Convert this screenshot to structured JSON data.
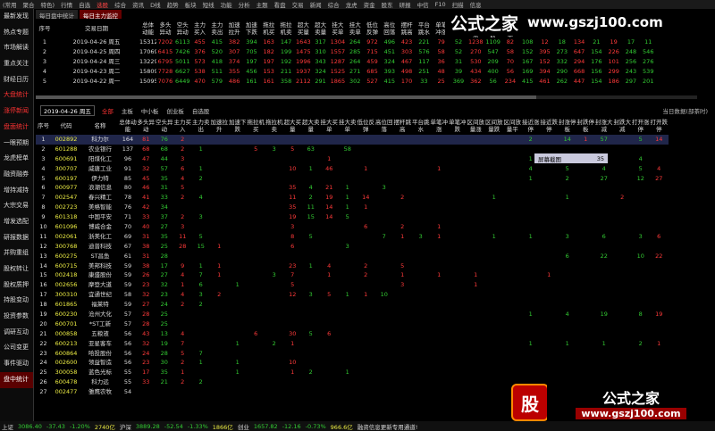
{
  "menu": [
    "(常用",
    "聚合",
    "特色)",
    "行情",
    "自选",
    "选股",
    "综合",
    "资讯",
    "D线",
    "趋势",
    "板块",
    "短线",
    "功能",
    "分析",
    "主题",
    "看盘",
    "交易",
    "新闻",
    "综合",
    "龙虎",
    "资金",
    "股东",
    "研报",
    "中信",
    "F10",
    "扫描",
    "信息"
  ],
  "menu_active_index": 5,
  "watermark": {
    "brand": "公式之家",
    "url": "www.gszj100.com"
  },
  "sidebar": [
    "最新发现",
    "热点专题",
    "市场解读",
    "重点关注",
    "财经日历",
    "大盘统计",
    "涨停新闻",
    "盘面统计",
    "一眼预期",
    "龙虎榜单",
    "融资融券",
    "增持减持",
    "大宗交易",
    "增发选配",
    "研报数据",
    "并购重组",
    "股权转让",
    "股权质押",
    "持股变动",
    "投资参数",
    "调研互动",
    "公司变更",
    "事件驱动",
    "盘中统计"
  ],
  "sidebar_red": [
    5,
    6,
    7
  ],
  "sidebar_selected": 23,
  "tabs": [
    "每日盘中统计",
    "每日主力监控"
  ],
  "top_table": {
    "headers": [
      "序号",
      "交易日期",
      "总体动能",
      "多头异动",
      "空头异动",
      "主力买入",
      "主力卖出",
      "加速拉升",
      "加速下跌",
      "拖拉机买",
      "拖拉机卖",
      "超大买量",
      "超大卖量",
      "挂大买单",
      "挂大卖单",
      "低位反弹",
      "高位回落",
      "摆杆跳高",
      "平台跳水",
      "单笔冲涨",
      "单笔冲跌",
      "区间放量涨",
      "区间放量跌",
      "区间放量平",
      "接近涨停",
      "接近跌停",
      "封涨停板",
      "封跌停板",
      "封涨大减",
      "封跌大减",
      "打开涨停",
      "打开跌停"
    ],
    "rows": [
      [
        "1",
        "2019-04-26 周五",
        "15312",
        "7202",
        "6113",
        "455",
        "415",
        "382",
        "394",
        "163",
        "147",
        "1643",
        "317",
        "1304",
        "264",
        "972",
        "496",
        "423",
        "221",
        "79",
        "52",
        "1238",
        "1109",
        "82",
        "108",
        "12",
        "18",
        "134",
        "21",
        "19",
        "17",
        "11"
      ],
      [
        "2",
        "2019-04-25 周四",
        "17069",
        "6415",
        "7426",
        "376",
        "520",
        "307",
        "705",
        "182",
        "199",
        "1475",
        "310",
        "1557",
        "285",
        "715",
        "451",
        "303",
        "576",
        "58",
        "52",
        "270",
        "547",
        "58",
        "152",
        "395",
        "273",
        "647",
        "154",
        "226",
        "248",
        "546"
      ],
      [
        "3",
        "2019-04-24 周三",
        "13229",
        "6795",
        "5011",
        "573",
        "418",
        "374",
        "197",
        "197",
        "192",
        "1996",
        "343",
        "1287",
        "264",
        "459",
        "324",
        "467",
        "117",
        "36",
        "31",
        "530",
        "209",
        "70",
        "167",
        "152",
        "332",
        "294",
        "176",
        "101",
        "256",
        "276"
      ],
      [
        "4",
        "2019-04-23 周二",
        "15809",
        "7728",
        "6627",
        "538",
        "511",
        "355",
        "456",
        "153",
        "211",
        "1937",
        "324",
        "1525",
        "271",
        "685",
        "393",
        "498",
        "251",
        "48",
        "39",
        "434",
        "400",
        "56",
        "169",
        "394",
        "290",
        "668",
        "156",
        "299",
        "243",
        "539"
      ],
      [
        "5",
        "2019-04-22 周一",
        "15095",
        "7076",
        "6449",
        "470",
        "579",
        "486",
        "161",
        "161",
        "358",
        "2112",
        "291",
        "1865",
        "302",
        "527",
        "415",
        "170",
        "33",
        "25",
        "369",
        "362",
        "56",
        "234",
        "415",
        "461",
        "262",
        "447",
        "154",
        "186",
        "297",
        "201"
      ]
    ]
  },
  "controls": {
    "date": "2019-04-26 周五",
    "options": [
      "全部",
      "主板",
      "中小板",
      "创业板",
      "自选股"
    ],
    "active_option": 0,
    "right_label": "当日数据(部茶时)"
  },
  "bottom_table": {
    "headers": [
      "序号",
      "代码",
      "名称",
      "总体动能",
      "多头异动",
      "空头异动",
      "主力买入",
      "主力卖出",
      "加速拉升",
      "加速下跌",
      "拖拉机买",
      "拖拉机卖",
      "超大买量",
      "超大卖量",
      "挂大买单",
      "挂大卖单",
      "低位反弹",
      "高位回落",
      "摆杆跳高",
      "平台跳水",
      "单笔冲涨",
      "单笔冲跌",
      "区间放量涨",
      "区间放量跌",
      "区间放量平",
      "接近涨停",
      "接近跌停",
      "封涨停板",
      "封跌停板",
      "封涨大减",
      "封跌大减",
      "打开涨停",
      "打开跌停"
    ],
    "rows": [
      [
        "1",
        "002892",
        "科力尔",
        "164",
        "81",
        "76",
        "2",
        "",
        "",
        "",
        "",
        "",
        "",
        "",
        "",
        "",
        "",
        "",
        "",
        "",
        "",
        "",
        "",
        "",
        "",
        "2",
        "",
        "14",
        "1",
        "57",
        "",
        "5",
        "14"
      ],
      [
        "2",
        "601288",
        "农业银行",
        "137",
        "68",
        "68",
        "2",
        "1",
        "",
        "",
        "5",
        "3",
        "5",
        "63",
        "",
        "58",
        "",
        "",
        "",
        "",
        "",
        "",
        "",
        "",
        "",
        "",
        "",
        "",
        "",
        "",
        "",
        "",
        ""
      ],
      [
        "3",
        "600691",
        "阳煤化工",
        "96",
        "47",
        "44",
        "3",
        "",
        "",
        "",
        "",
        "",
        "",
        "",
        "1",
        "",
        "",
        "",
        "",
        "",
        "",
        "",
        "",
        "",
        "",
        "1",
        "",
        "5",
        "4",
        "2",
        "",
        "4",
        ""
      ],
      [
        "4",
        "300707",
        "威唐工业",
        "91",
        "32",
        "57",
        "6",
        "1",
        "",
        "",
        "",
        "",
        "10",
        "1",
        "46",
        "",
        "1",
        "",
        "",
        "",
        "1",
        "",
        "",
        "",
        "",
        "4",
        "",
        "5",
        "",
        "4",
        "",
        "5",
        "4"
      ],
      [
        "5",
        "600197",
        "伊力特",
        "85",
        "45",
        "35",
        "4",
        "2",
        "",
        "",
        "",
        "",
        "",
        "",
        "",
        "",
        "",
        "",
        "",
        "",
        "",
        "",
        "",
        "",
        "",
        "1",
        "",
        "2",
        "",
        "27",
        "",
        "12",
        "27"
      ],
      [
        "6",
        "000977",
        "浪潮信息",
        "80",
        "46",
        "31",
        "5",
        "",
        "",
        "",
        "",
        "",
        "35",
        "4",
        "21",
        "1",
        "",
        "3",
        "",
        "",
        "",
        "",
        "",
        "",
        "",
        "",
        "",
        "",
        "",
        "",
        "",
        "",
        ""
      ],
      [
        "7",
        "002547",
        "春兴精工",
        "78",
        "41",
        "33",
        "2",
        "4",
        "",
        "",
        "",
        "",
        "11",
        "2",
        "19",
        "1",
        "14",
        "",
        "2",
        "",
        "",
        "",
        "",
        "1",
        "",
        "",
        "",
        "1",
        "",
        "",
        "2",
        "",
        ""
      ],
      [
        "8",
        "002723",
        "美格智能",
        "76",
        "42",
        "34",
        "",
        "",
        "",
        "",
        "",
        "",
        "35",
        "11",
        "14",
        "1",
        "1",
        "",
        "",
        "",
        "",
        "",
        "",
        "",
        "",
        "",
        "",
        "",
        "",
        "",
        "",
        "",
        ""
      ],
      [
        "9",
        "601318",
        "中国平安",
        "71",
        "33",
        "37",
        "2",
        "3",
        "",
        "",
        "",
        "",
        "19",
        "15",
        "14",
        "5",
        "",
        "",
        "",
        "",
        "",
        "",
        "",
        "",
        "",
        "",
        "",
        "",
        "",
        "",
        "",
        "",
        ""
      ],
      [
        "10",
        "601096",
        "博威合金",
        "70",
        "40",
        "27",
        "3",
        "",
        "",
        "",
        "",
        "",
        "3",
        "",
        "",
        "",
        "6",
        "",
        "2",
        "",
        "1",
        "",
        "",
        "",
        "",
        "",
        "",
        "",
        "",
        "",
        "",
        "",
        ""
      ],
      [
        "11",
        "002061",
        "浙美化工",
        "69",
        "31",
        "35",
        "11",
        "5",
        "",
        "",
        "",
        "",
        "8",
        "5",
        "",
        "",
        "",
        "7",
        "1",
        "3",
        "1",
        "",
        "",
        "1",
        "",
        "1",
        "",
        "3",
        "",
        "6",
        "",
        "3",
        "6"
      ],
      [
        "12",
        "300768",
        "迪普科技",
        "67",
        "38",
        "25",
        "28",
        "15",
        "1",
        "",
        "",
        "",
        "6",
        "",
        "",
        "3",
        "",
        "",
        "",
        "",
        "",
        "",
        "",
        "",
        "",
        "",
        "",
        "",
        "",
        "",
        "",
        "",
        ""
      ],
      [
        "13",
        "600275",
        "ST昌鱼",
        "61",
        "31",
        "28",
        "",
        "",
        "",
        "",
        "",
        "",
        "",
        "",
        "",
        "",
        "",
        "",
        "",
        "",
        "",
        "",
        "",
        "",
        "",
        "",
        "",
        "6",
        "",
        "22",
        "",
        "10",
        "22"
      ],
      [
        "14",
        "600715",
        "美邦科技",
        "59",
        "38",
        "17",
        "9",
        "1",
        "1",
        "",
        "",
        "",
        "23",
        "1",
        "4",
        "",
        "2",
        "",
        "5",
        "",
        "",
        "",
        "",
        "",
        "",
        "",
        "",
        "",
        "",
        "",
        "",
        "",
        ""
      ],
      [
        "15",
        "002418",
        "康盛股份",
        "59",
        "26",
        "27",
        "4",
        "7",
        "1",
        "",
        "",
        "3",
        "7",
        "",
        "1",
        "",
        "2",
        "",
        "1",
        "",
        "1",
        "",
        "1",
        "",
        "",
        "",
        "1",
        "",
        "",
        "",
        "",
        "",
        ""
      ],
      [
        "16",
        "002656",
        "摩登大道",
        "59",
        "23",
        "32",
        "1",
        "6",
        "",
        "1",
        "",
        "",
        "5",
        "",
        "",
        "",
        "",
        "",
        "3",
        "",
        "",
        "",
        "1",
        "",
        "",
        "",
        "",
        "",
        "",
        "",
        "",
        "",
        ""
      ],
      [
        "17",
        "300310",
        "宜通世纪",
        "58",
        "32",
        "23",
        "4",
        "3",
        "2",
        "",
        "",
        "",
        "12",
        "3",
        "5",
        "1",
        "1",
        "10",
        "",
        "",
        "",
        "",
        "",
        "",
        "",
        "",
        "",
        "",
        "",
        "",
        "",
        "",
        ""
      ],
      [
        "18",
        "601865",
        "福莱特",
        "59",
        "27",
        "24",
        "2",
        "2",
        "",
        "",
        "",
        "",
        "",
        "",
        "",
        "",
        "",
        "",
        "",
        "",
        "",
        "",
        "",
        "",
        "",
        "",
        "",
        "",
        "",
        "",
        "",
        "",
        ""
      ],
      [
        "19",
        "600230",
        "沧州大化",
        "57",
        "28",
        "25",
        "",
        "",
        "",
        "",
        "",
        "",
        "",
        "",
        "",
        "",
        "",
        "",
        "",
        "",
        "",
        "",
        "",
        "",
        "",
        "1",
        "",
        "4",
        "",
        "19",
        "",
        "8",
        "19"
      ],
      [
        "20",
        "600701",
        "*ST工新",
        "57",
        "28",
        "25",
        "",
        "",
        "",
        "",
        "",
        "",
        "",
        "",
        "",
        "",
        "",
        "",
        "",
        "",
        "",
        "",
        "",
        "",
        "",
        "",
        "",
        "",
        "",
        "",
        "",
        "",
        ""
      ],
      [
        "21",
        "000858",
        "五粮液",
        "56",
        "43",
        "13",
        "4",
        "",
        "",
        "",
        "6",
        "",
        "30",
        "5",
        "6",
        "",
        "",
        "",
        "",
        "",
        "",
        "",
        "",
        "",
        "",
        "",
        "",
        "",
        "",
        "",
        "",
        "",
        ""
      ],
      [
        "22",
        "600213",
        "亚星客车",
        "56",
        "32",
        "19",
        "7",
        "",
        "",
        "1",
        "",
        "2",
        "1",
        "",
        "",
        "",
        "",
        "",
        "",
        "",
        "",
        "",
        "",
        "",
        "",
        "1",
        "",
        "1",
        "",
        "1",
        "",
        "2",
        "1"
      ],
      [
        "23",
        "600864",
        "哈投股份",
        "56",
        "24",
        "28",
        "5",
        "7",
        "",
        "",
        "",
        "",
        "",
        "",
        "",
        "",
        "",
        "",
        "",
        "",
        "",
        "",
        "",
        "",
        "",
        "",
        "",
        "",
        "",
        "",
        "",
        "",
        ""
      ],
      [
        "24",
        "002600",
        "领益智造",
        "56",
        "23",
        "30",
        "2",
        "1",
        "",
        "1",
        "",
        "",
        "10",
        "",
        "",
        "",
        "",
        "",
        "",
        "",
        "",
        "",
        "",
        "",
        "",
        "",
        "",
        "",
        "",
        "",
        "",
        "",
        ""
      ],
      [
        "25",
        "300058",
        "蓝色光标",
        "55",
        "17",
        "35",
        "1",
        "",
        "",
        "1",
        "",
        "",
        "1",
        "2",
        "",
        "1",
        "",
        "",
        "",
        "",
        "",
        "",
        "",
        "",
        "",
        "",
        "",
        "",
        "",
        "",
        "",
        "",
        ""
      ],
      [
        "26",
        "600478",
        "科力远",
        "55",
        "33",
        "21",
        "2",
        "2",
        "",
        "",
        "",
        "",
        "",
        "",
        "",
        "",
        "",
        "",
        "",
        "",
        "",
        "",
        "",
        "",
        "",
        "",
        "",
        "",
        "",
        "",
        "",
        "",
        ""
      ],
      [
        "27",
        "002477",
        "雏鹰农牧",
        "54",
        "",
        "",
        "",
        "",
        "",
        "",
        "",
        "",
        "",
        "",
        "",
        "",
        "",
        "",
        "",
        "",
        "",
        "",
        "",
        "",
        "",
        "",
        "",
        "",
        "",
        "",
        "",
        "",
        ""
      ]
    ]
  },
  "popup": {
    "label": "屏幕截图",
    "value": "35"
  },
  "status": {
    "sh_label": "上证",
    "sh_value": "3086.40",
    "sh_change": "-37.43",
    "sh_pct": "-1.20%",
    "sh_amount": "2740亿",
    "sz_label": "沪深",
    "sz_value": "3889.28",
    "sz_change": "-52.54",
    "sz_pct": "-1.33%",
    "sz_amount": "1866亿",
    "cy_label": "创业",
    "cy_value": "1657.82",
    "cy_change": "-12.16",
    "cy_pct": "-0.73%",
    "cy_amount": "966.6亿",
    "msg": "融资信息更新专用通道!"
  },
  "banner": {
    "badge": "股",
    "brand": "公式之家",
    "url": "www.gszj100.com"
  },
  "colors": {
    "red": "#ff3a3a",
    "green": "#33cc33",
    "yellow": "#eeee44",
    "accent": "#600000"
  }
}
